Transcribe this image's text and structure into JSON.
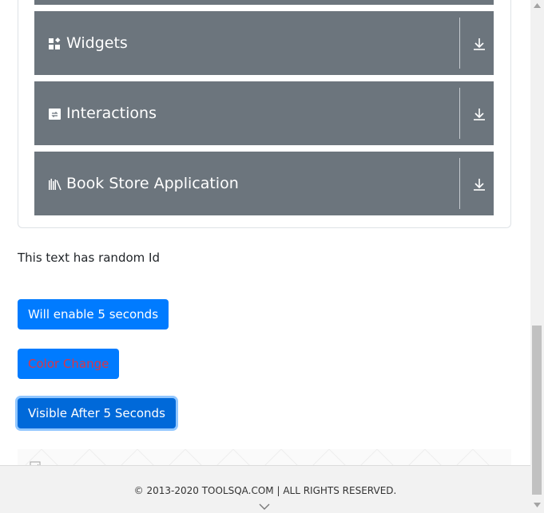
{
  "menu": {
    "groups": [
      {
        "title": "Widgets",
        "icon": "widgets-icon"
      },
      {
        "title": "Interactions",
        "icon": "interactions-icon"
      },
      {
        "title": "Book Store Application",
        "icon": "book-store-icon"
      }
    ]
  },
  "main": {
    "random_id_text": "This text has random Id",
    "buttons": {
      "enable_after": "Will enable 5 seconds",
      "color_change": "Color Change",
      "visible_after": "Visible After 5 Seconds"
    }
  },
  "footer": {
    "copyright": "© 2013-2020 TOOLSQA.COM | ALL RIGHTS RESERVED."
  },
  "colors": {
    "group_bg": "#6c757d",
    "primary": "#007bff",
    "danger_text": "#dc3545",
    "footer_bg": "#f2f2f2"
  }
}
